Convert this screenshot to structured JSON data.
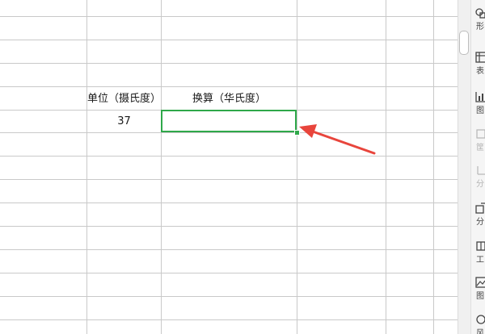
{
  "spreadsheet": {
    "header_unit": "单位（摄氏度）",
    "header_convert": "换算（华氏度）",
    "value_celsius": "37",
    "value_fahrenheit": ""
  },
  "side_panel": {
    "items": [
      {
        "label": "形",
        "icon": "shape-icon",
        "enabled": true
      },
      {
        "label": "表",
        "icon": "table-icon",
        "enabled": true
      },
      {
        "label": "图",
        "icon": "chart-icon",
        "enabled": true
      },
      {
        "label": "筐",
        "icon": "filter-icon",
        "enabled": false
      },
      {
        "label": "分",
        "icon": "split-icon",
        "enabled": false
      },
      {
        "label": "分",
        "icon": "share-icon",
        "enabled": true
      },
      {
        "label": "工",
        "icon": "tools-icon",
        "enabled": true
      },
      {
        "label": "图",
        "icon": "image-icon",
        "enabled": true
      },
      {
        "label": "风",
        "icon": "style-icon",
        "enabled": true
      }
    ]
  },
  "colors": {
    "active_cell_border": "#2fa84a",
    "arrow": "#e8453c",
    "grid": "#c9c9c9"
  }
}
